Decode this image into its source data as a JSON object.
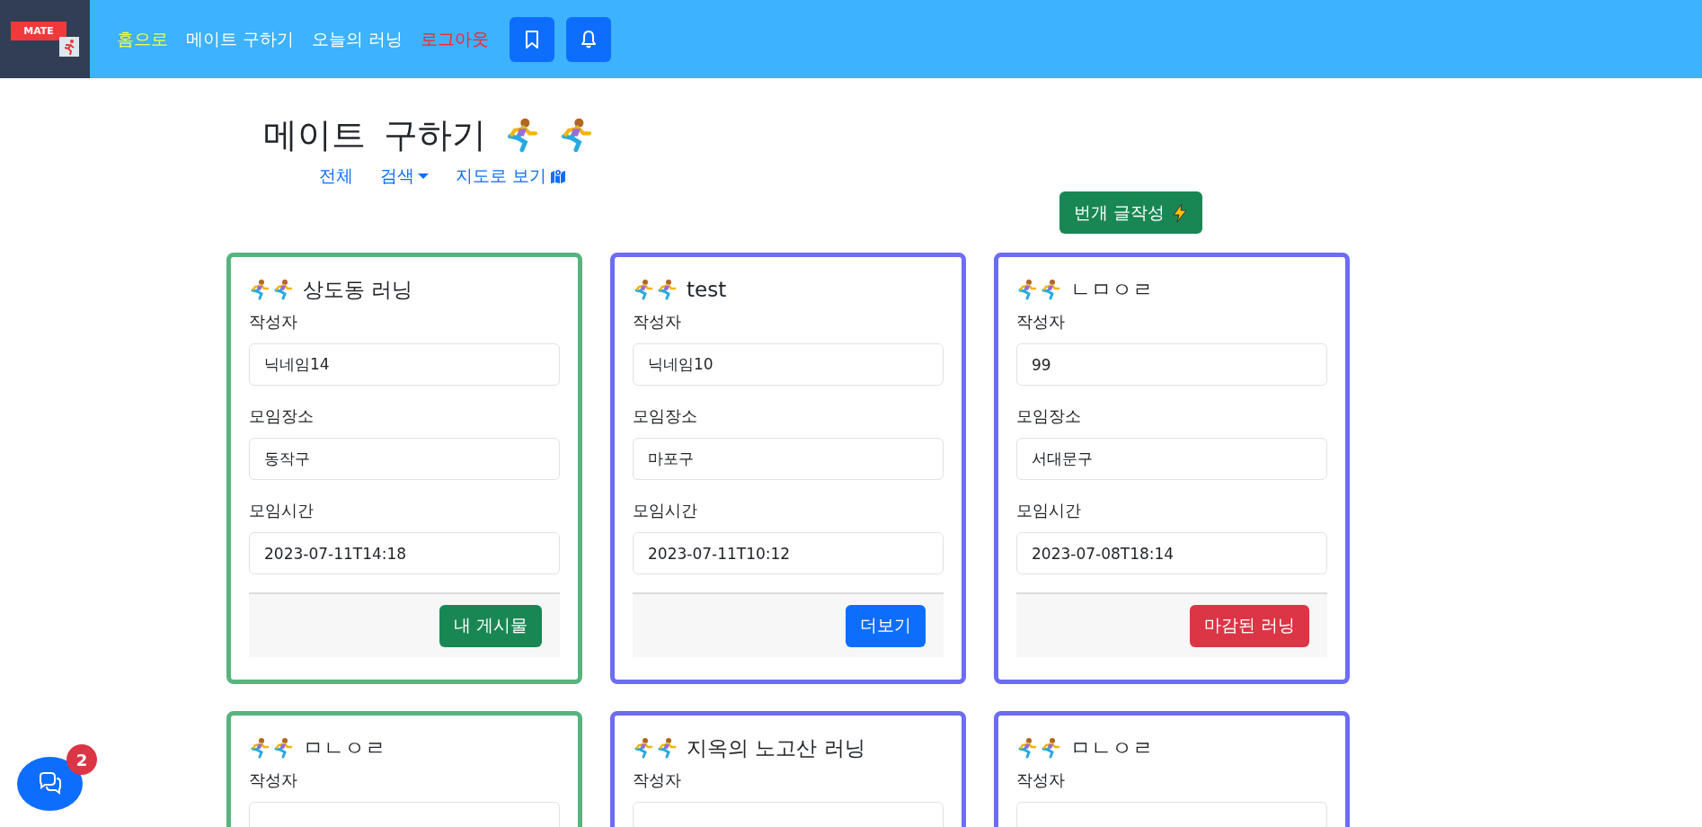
{
  "logo": {
    "text": "MATE"
  },
  "nav": [
    {
      "label": "홈으로",
      "selected": true,
      "kind": "link"
    },
    {
      "label": "메이트 구하기",
      "selected": false,
      "kind": "link"
    },
    {
      "label": "오늘의 러닝",
      "selected": false,
      "kind": "link"
    },
    {
      "label": "로그아웃",
      "selected": false,
      "kind": "logout"
    }
  ],
  "page_title": "메이트 구하기",
  "filters": [
    {
      "label": "전체",
      "kind": "plain"
    },
    {
      "label": "검색",
      "kind": "dropdown"
    },
    {
      "label": "지도로 보기",
      "kind": "map"
    }
  ],
  "create_button": "번개 글작성",
  "cards": [
    {
      "title": "상도동 러닝",
      "mine": true,
      "fields": [
        {
          "label": "작성자",
          "value": "닉네임14"
        },
        {
          "label": "모임장소",
          "value": "동작구"
        },
        {
          "label": "모임시간",
          "value": "2023-07-11T14:18"
        }
      ],
      "action": {
        "label": "내 게시물",
        "kind": "mine"
      }
    },
    {
      "title": "test",
      "mine": false,
      "fields": [
        {
          "label": "작성자",
          "value": "닉네임10"
        },
        {
          "label": "모임장소",
          "value": "마포구"
        },
        {
          "label": "모임시간",
          "value": "2023-07-11T10:12"
        }
      ],
      "action": {
        "label": "더보기",
        "kind": "open"
      }
    },
    {
      "title": "ㄴㅁㅇㄹ",
      "mine": false,
      "fields": [
        {
          "label": "작성자",
          "value": "99"
        },
        {
          "label": "모임장소",
          "value": "서대문구"
        },
        {
          "label": "모임시간",
          "value": "2023-07-08T18:14"
        }
      ],
      "action": {
        "label": "마감된 러닝",
        "kind": "closed"
      }
    },
    {
      "title": "ㅁㄴㅇㄹ",
      "mine": true,
      "fields": [
        {
          "label": "작성자"
        }
      ]
    },
    {
      "title": "지옥의 노고산 러닝",
      "mine": false,
      "fields": [
        {
          "label": "작성자"
        }
      ]
    },
    {
      "title": "ㅁㄴㅇㄹ",
      "mine": false,
      "fields": [
        {
          "label": "작성자"
        }
      ]
    }
  ],
  "chat": {
    "badge": "2"
  }
}
